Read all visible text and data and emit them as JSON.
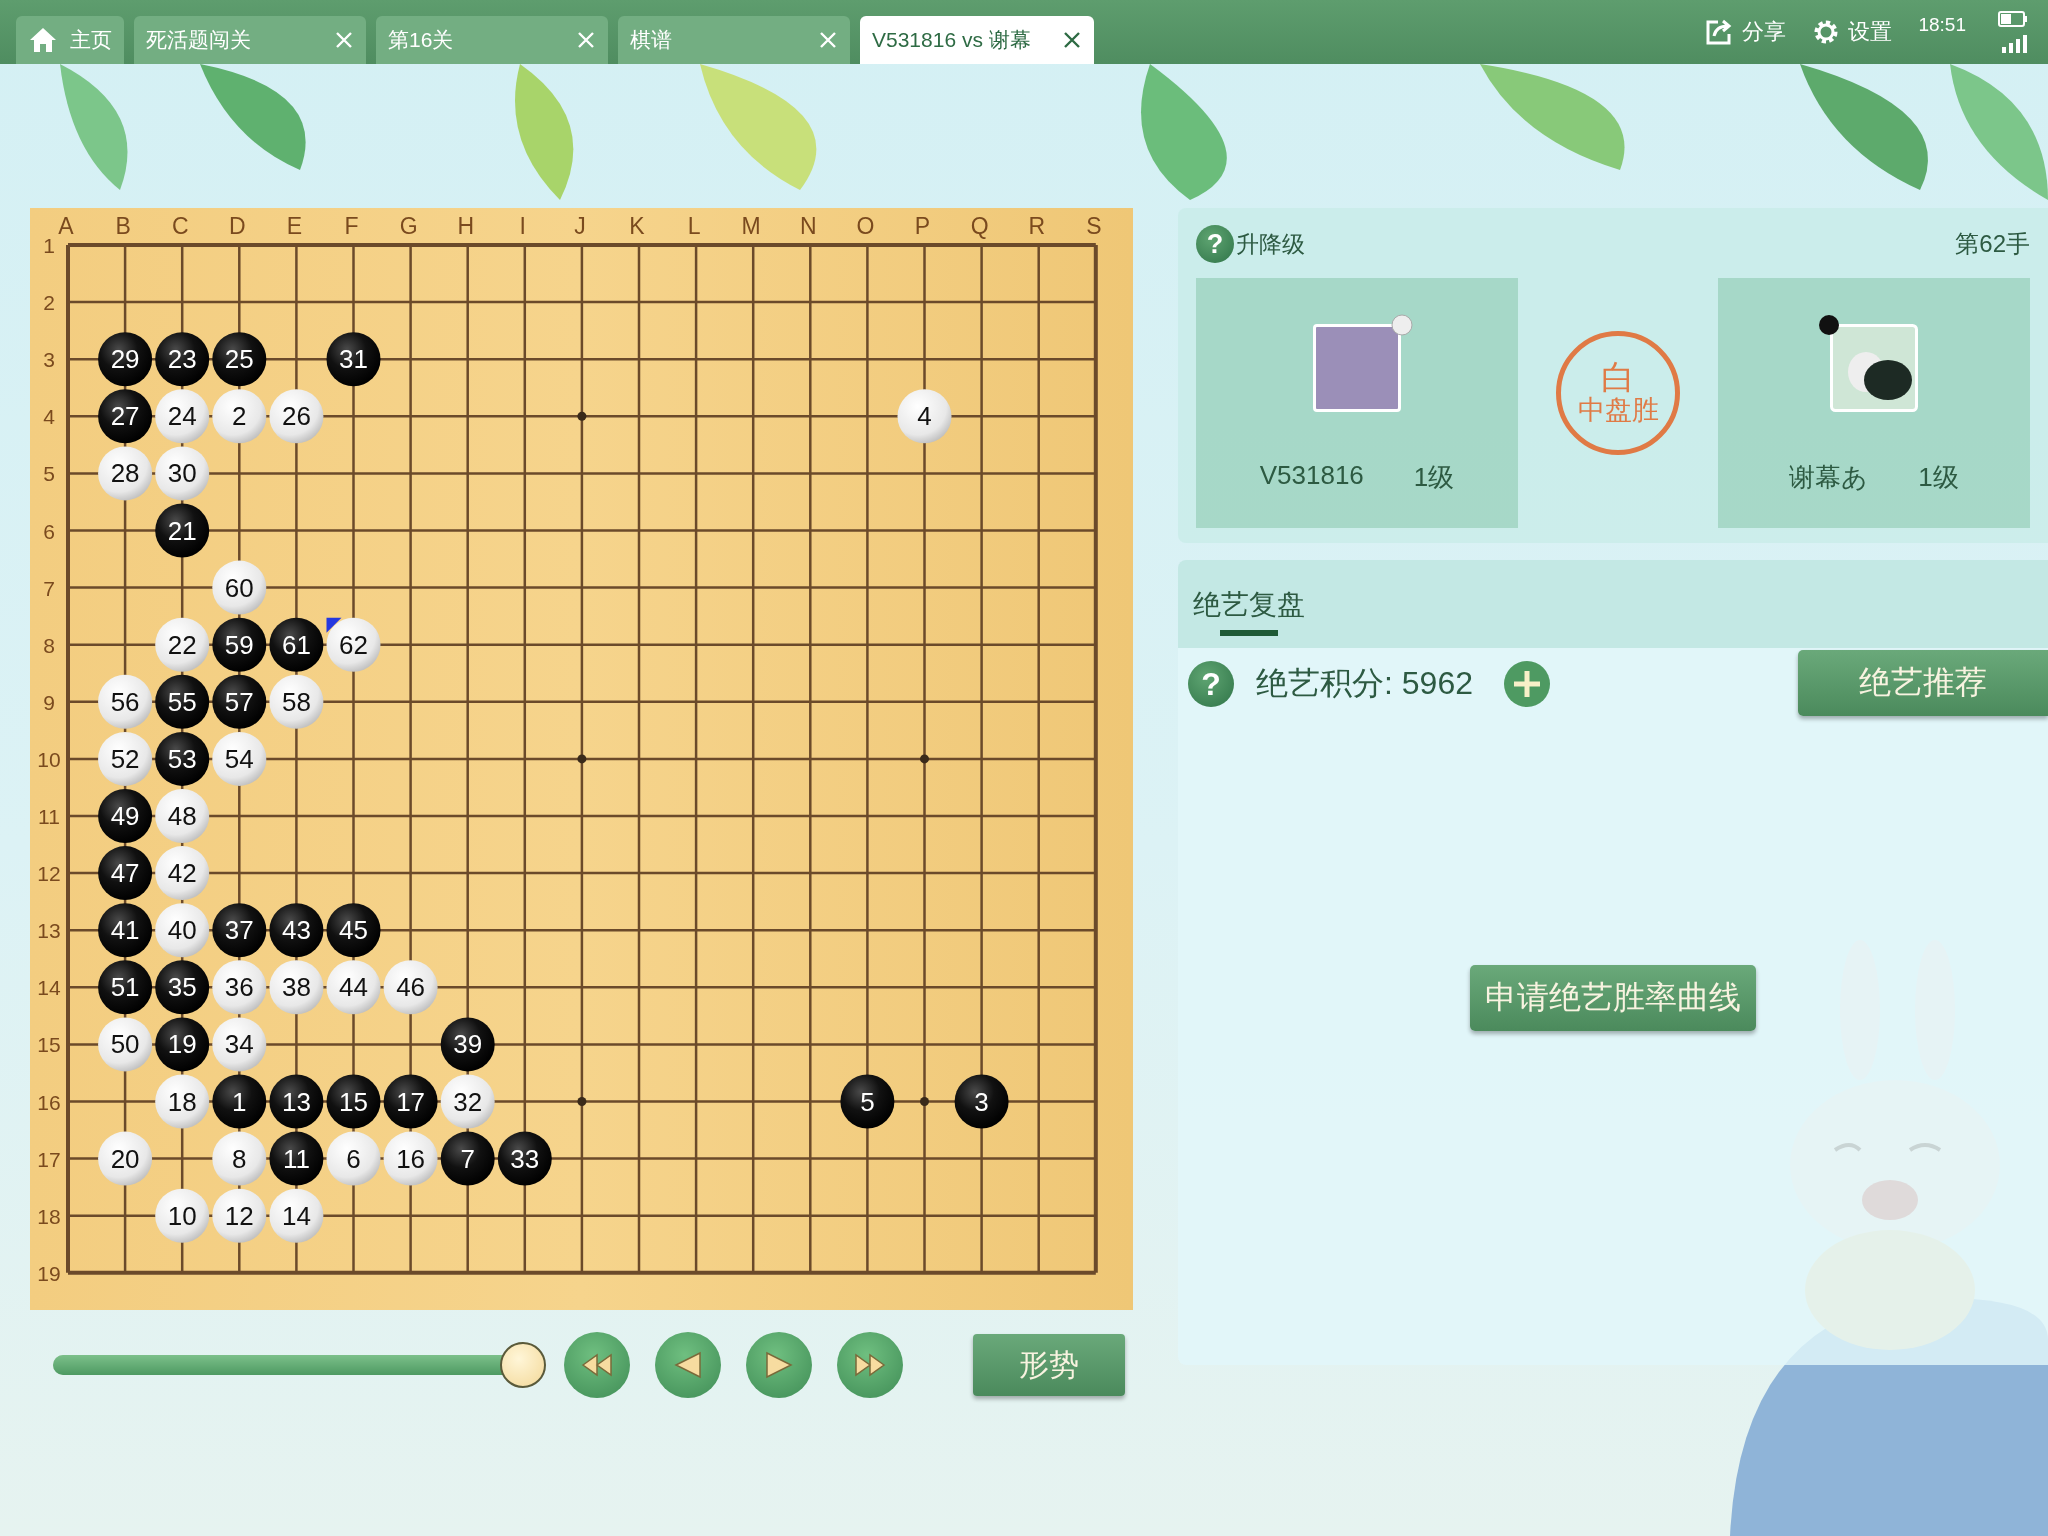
{
  "tabs": [
    {
      "label": "主页",
      "kind": "home",
      "closable": false,
      "selected": false
    },
    {
      "label": "死活题闯关",
      "kind": "page",
      "closable": true,
      "selected": false
    },
    {
      "label": "第16关",
      "kind": "page",
      "closable": true,
      "selected": false
    },
    {
      "label": "棋谱",
      "kind": "page",
      "closable": true,
      "selected": false
    },
    {
      "label": "V531816 vs 谢幕",
      "kind": "page",
      "closable": true,
      "selected": true
    }
  ],
  "status": {
    "share": "分享",
    "settings": "设置",
    "time": "18:51"
  },
  "board": {
    "columns": [
      "A",
      "B",
      "C",
      "D",
      "E",
      "F",
      "G",
      "H",
      "I",
      "J",
      "K",
      "L",
      "M",
      "N",
      "O",
      "P",
      "Q",
      "R",
      "S"
    ],
    "rows": [
      {
        "label": "1"
      },
      {
        "label": "2"
      },
      {
        "label": "3",
        "points": [
          {
            "kind": "empty"
          },
          {
            "kind": "black",
            "label": "29",
            "last_move": false
          },
          {
            "kind": "black",
            "label": "23",
            "last_move": false
          },
          {
            "kind": "black",
            "label": "25",
            "last_move": false
          },
          {
            "kind": "empty"
          },
          {
            "kind": "black",
            "label": "31",
            "last_move": false
          }
        ]
      },
      {
        "label": "4",
        "points": [
          {
            "kind": "empty"
          },
          {
            "kind": "black",
            "label": "27",
            "last_move": false
          },
          {
            "kind": "white",
            "label": "24",
            "last_move": false
          },
          {
            "kind": "white",
            "label": "2",
            "last_move": false
          },
          {
            "kind": "white",
            "label": "26",
            "last_move": false
          },
          {
            "kind": "empty"
          },
          {
            "kind": "empty"
          },
          {
            "kind": "empty"
          },
          {
            "kind": "empty"
          },
          {
            "kind": "empty"
          },
          {
            "kind": "empty"
          },
          {
            "kind": "empty"
          },
          {
            "kind": "empty"
          },
          {
            "kind": "empty"
          },
          {
            "kind": "empty"
          },
          {
            "kind": "white",
            "label": "4",
            "last_move": false
          }
        ]
      },
      {
        "label": "5",
        "points": [
          {
            "kind": "empty"
          },
          {
            "kind": "white",
            "label": "28",
            "last_move": false
          },
          {
            "kind": "white",
            "label": "30",
            "last_move": false
          }
        ]
      },
      {
        "label": "6",
        "points": [
          {
            "kind": "empty"
          },
          {
            "kind": "empty"
          },
          {
            "kind": "black",
            "label": "21",
            "last_move": false
          }
        ]
      },
      {
        "label": "7",
        "points": [
          {
            "kind": "empty"
          },
          {
            "kind": "empty"
          },
          {
            "kind": "empty"
          },
          {
            "kind": "white",
            "label": "60",
            "last_move": false
          }
        ]
      },
      {
        "label": "8",
        "points": [
          {
            "kind": "empty"
          },
          {
            "kind": "empty"
          },
          {
            "kind": "white",
            "label": "22",
            "last_move": false
          },
          {
            "kind": "black",
            "label": "59",
            "last_move": false
          },
          {
            "kind": "black",
            "label": "61",
            "last_move": false
          },
          {
            "kind": "white",
            "label": "62",
            "last_move": true
          }
        ]
      },
      {
        "label": "9",
        "points": [
          {
            "kind": "empty"
          },
          {
            "kind": "white",
            "label": "56",
            "last_move": false
          },
          {
            "kind": "black",
            "label": "55",
            "last_move": false
          },
          {
            "kind": "black",
            "label": "57",
            "last_move": false
          },
          {
            "kind": "white",
            "label": "58",
            "last_move": false
          }
        ]
      },
      {
        "label": "10",
        "points": [
          {
            "kind": "empty"
          },
          {
            "kind": "white",
            "label": "52",
            "last_move": false
          },
          {
            "kind": "black",
            "label": "53",
            "last_move": false
          },
          {
            "kind": "white",
            "label": "54",
            "last_move": false
          }
        ]
      },
      {
        "label": "11",
        "points": [
          {
            "kind": "empty"
          },
          {
            "kind": "black",
            "label": "49",
            "last_move": false
          },
          {
            "kind": "white",
            "label": "48",
            "last_move": false
          }
        ]
      },
      {
        "label": "12",
        "points": [
          {
            "kind": "empty"
          },
          {
            "kind": "black",
            "label": "47",
            "last_move": false
          },
          {
            "kind": "white",
            "label": "42",
            "last_move": false
          }
        ]
      },
      {
        "label": "13",
        "points": [
          {
            "kind": "empty"
          },
          {
            "kind": "black",
            "label": "41",
            "last_move": false
          },
          {
            "kind": "white",
            "label": "40",
            "last_move": false
          },
          {
            "kind": "black",
            "label": "37",
            "last_move": false
          },
          {
            "kind": "black",
            "label": "43",
            "last_move": false
          },
          {
            "kind": "black",
            "label": "45",
            "last_move": false
          }
        ]
      },
      {
        "label": "14",
        "points": [
          {
            "kind": "empty"
          },
          {
            "kind": "black",
            "label": "51",
            "last_move": false
          },
          {
            "kind": "black",
            "label": "35",
            "last_move": false
          },
          {
            "kind": "white",
            "label": "36",
            "last_move": false
          },
          {
            "kind": "white",
            "label": "38",
            "last_move": false
          },
          {
            "kind": "white",
            "label": "44",
            "last_move": false
          },
          {
            "kind": "white",
            "label": "46",
            "last_move": false
          }
        ]
      },
      {
        "label": "15",
        "points": [
          {
            "kind": "empty"
          },
          {
            "kind": "white",
            "label": "50",
            "last_move": false
          },
          {
            "kind": "black",
            "label": "19",
            "last_move": false
          },
          {
            "kind": "white",
            "label": "34",
            "last_move": false
          },
          {
            "kind": "empty"
          },
          {
            "kind": "empty"
          },
          {
            "kind": "empty"
          },
          {
            "kind": "black",
            "label": "39",
            "last_move": false
          }
        ]
      },
      {
        "label": "16",
        "points": [
          {
            "kind": "empty"
          },
          {
            "kind": "empty"
          },
          {
            "kind": "white",
            "label": "18",
            "last_move": false
          },
          {
            "kind": "black",
            "label": "1",
            "last_move": false
          },
          {
            "kind": "black",
            "label": "13",
            "last_move": false
          },
          {
            "kind": "black",
            "label": "15",
            "last_move": false
          },
          {
            "kind": "black",
            "label": "17",
            "last_move": false
          },
          {
            "kind": "white",
            "label": "32",
            "last_move": false
          },
          {
            "kind": "empty"
          },
          {
            "kind": "empty"
          },
          {
            "kind": "empty"
          },
          {
            "kind": "empty"
          },
          {
            "kind": "empty"
          },
          {
            "kind": "empty"
          },
          {
            "kind": "black",
            "label": "5",
            "last_move": false
          },
          {
            "kind": "empty"
          },
          {
            "kind": "black",
            "label": "3",
            "last_move": false
          }
        ]
      },
      {
        "label": "17",
        "points": [
          {
            "kind": "empty"
          },
          {
            "kind": "white",
            "label": "20",
            "last_move": false
          },
          {
            "kind": "empty"
          },
          {
            "kind": "white",
            "label": "8",
            "last_move": false
          },
          {
            "kind": "black",
            "label": "11",
            "last_move": false
          },
          {
            "kind": "white",
            "label": "6",
            "last_move": false
          },
          {
            "kind": "white",
            "label": "16",
            "last_move": false
          },
          {
            "kind": "black",
            "label": "7",
            "last_move": false
          },
          {
            "kind": "black",
            "label": "33",
            "last_move": false
          }
        ]
      },
      {
        "label": "18",
        "points": [
          {
            "kind": "empty"
          },
          {
            "kind": "empty"
          },
          {
            "kind": "white",
            "label": "10",
            "last_move": false
          },
          {
            "kind": "white",
            "label": "12",
            "last_move": false
          },
          {
            "kind": "white",
            "label": "14",
            "last_move": false
          }
        ]
      },
      {
        "label": "19"
      }
    ]
  },
  "replay": {
    "level": 1,
    "situation_button": "形势"
  },
  "game_info": {
    "help_icon": "?",
    "help_label": "升降级",
    "move_count": "第62手",
    "players": [
      {
        "name": "V531816",
        "rank": "1级",
        "plays_black": false,
        "kind": "photo"
      },
      {
        "name": "谢幕あ",
        "rank": "1级",
        "plays_black": true,
        "kind": "logo"
      }
    ],
    "result": {
      "winner": "白",
      "method": "中盘胜"
    }
  },
  "analysis": {
    "tabs": [
      {
        "label": "绝艺复盘",
        "selected": true
      }
    ],
    "help_icon": "?",
    "score": "绝艺积分: 5962",
    "recommend_button": "绝艺推荐",
    "curve_button": "申请绝艺胜率曲线"
  }
}
